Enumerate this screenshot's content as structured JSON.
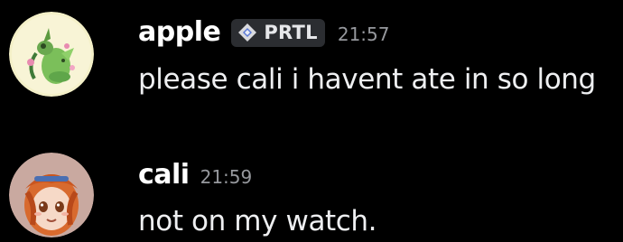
{
  "messages": [
    {
      "author": "apple",
      "tag": {
        "label": "PRTL",
        "icon": "diamond-sparkle-icon"
      },
      "timestamp": "21:57",
      "content": "please cali i havent ate in so long",
      "avatar": "avatar-apple"
    },
    {
      "author": "cali",
      "timestamp": "21:59",
      "content": "not on my watch.",
      "avatar": "avatar-cali"
    }
  ],
  "colors": {
    "background": "#000000",
    "username": "#ffffff",
    "content": "#eeeff1",
    "timestamp": "#96989d",
    "tag_background": "#2b2d31",
    "tag_text": "#e6e7ea"
  }
}
